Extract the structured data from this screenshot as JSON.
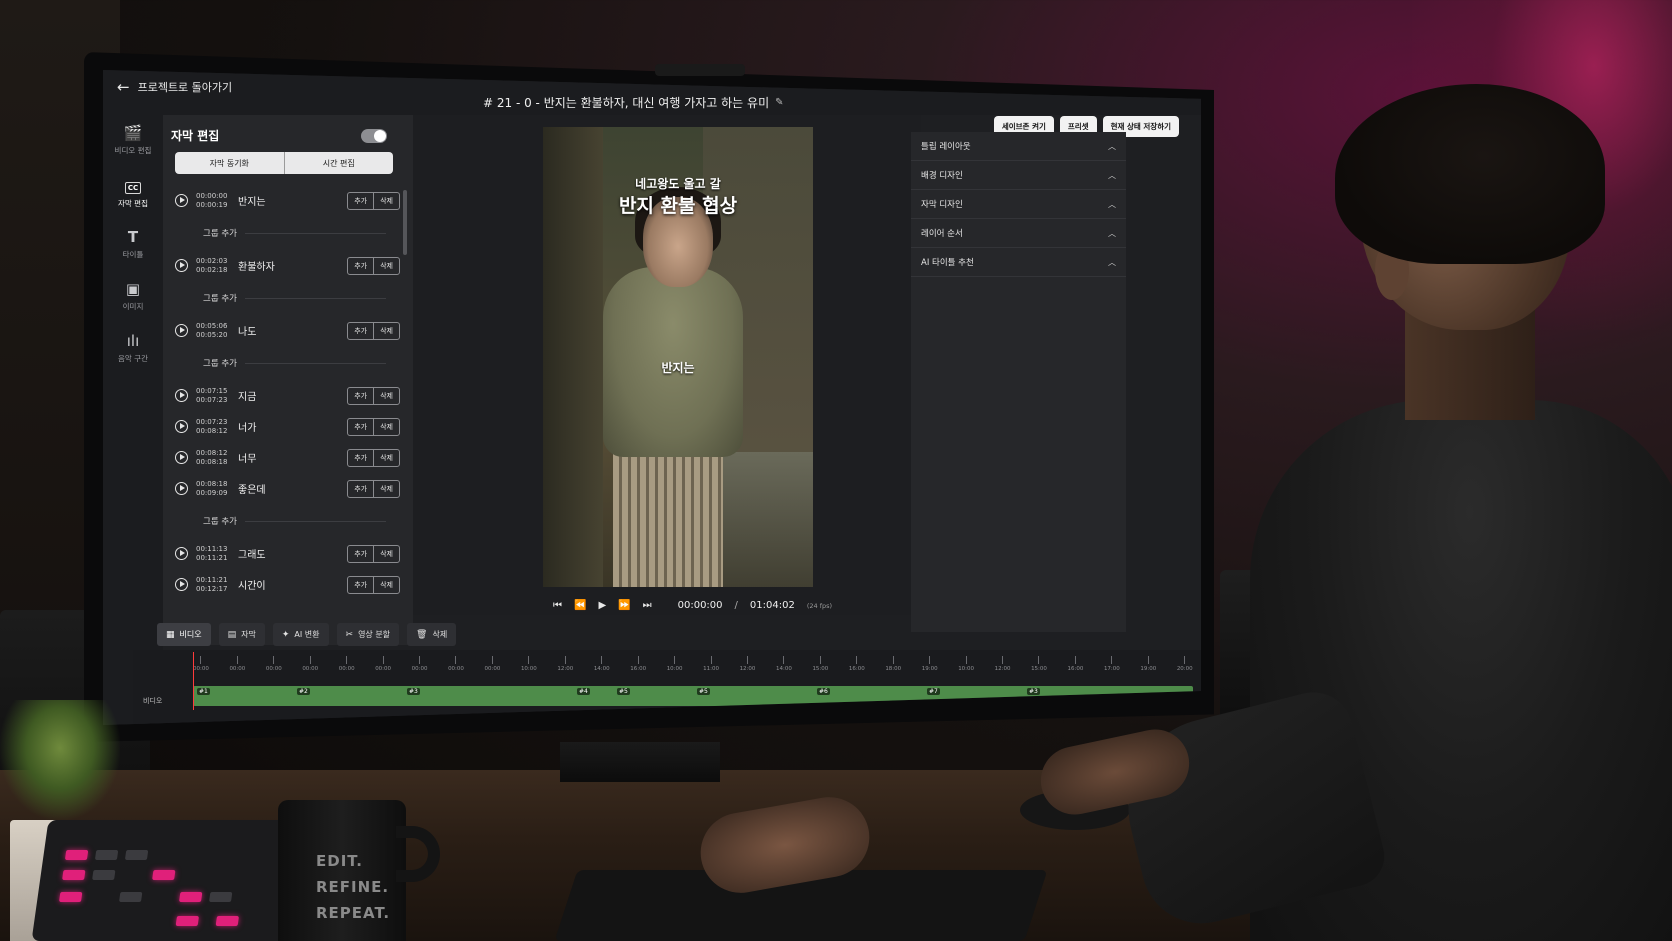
{
  "header": {
    "back_label": "프로젝트로 돌아가기",
    "project_title": "# 21 - 0 - 반지는 환불하자, 대신 여행 가자고 하는 유미",
    "actions": [
      "세이브존 켜기",
      "프리셋",
      "현재 상태 저장하기"
    ]
  },
  "rail": {
    "items": [
      {
        "label": "비디오 편집",
        "icon": "film-icon"
      },
      {
        "label": "자막 편집",
        "icon": "cc-icon"
      },
      {
        "label": "타이틀",
        "icon": "text-icon"
      },
      {
        "label": "이미지",
        "icon": "image-icon"
      },
      {
        "label": "음악 구간",
        "icon": "audio-wave-icon"
      }
    ]
  },
  "subtitle_panel": {
    "title": "자막 편집",
    "toggle_on": true,
    "tabs": [
      "자막 동기화",
      "시간 편집"
    ],
    "add_label": "추가",
    "delete_label": "삭제",
    "group_add_label": "그룹 추가",
    "groups": [
      {
        "rows": [
          {
            "start": "00:00:00",
            "end": "00:00:19",
            "text": "반지는"
          }
        ]
      },
      {
        "rows": [
          {
            "start": "00:02:03",
            "end": "00:02:18",
            "text": "환불하자"
          }
        ]
      },
      {
        "rows": [
          {
            "start": "00:05:06",
            "end": "00:05:20",
            "text": "나도"
          }
        ]
      },
      {
        "rows": [
          {
            "start": "00:07:15",
            "end": "00:07:23",
            "text": "지금"
          },
          {
            "start": "00:07:23",
            "end": "00:08:12",
            "text": "너가"
          },
          {
            "start": "00:08:12",
            "end": "00:08:18",
            "text": "너무"
          },
          {
            "start": "00:08:18",
            "end": "00:09:09",
            "text": "좋은데"
          }
        ]
      },
      {
        "rows": [
          {
            "start": "00:11:13",
            "end": "00:11:21",
            "text": "그래도"
          },
          {
            "start": "00:11:21",
            "end": "00:12:17",
            "text": "시간이"
          }
        ]
      }
    ]
  },
  "preview": {
    "caption_small": "네고왕도 울고 갈",
    "caption_big": "반지 환불 협상",
    "caption_mid": "반지는",
    "current_time": "00:00:00",
    "separator": "/",
    "total_time": "01:04:02",
    "fps": "(24 fps)"
  },
  "right_panel": {
    "sections": [
      "틀립 레이아웃",
      "배경 디자인",
      "자막 디자인",
      "레이어 순서",
      "AI 타이틀 추천"
    ]
  },
  "bottom_toolbar": {
    "buttons": [
      {
        "label": "비디오",
        "icon": "film-icon"
      },
      {
        "label": "자막",
        "icon": "cc-icon"
      },
      {
        "label": "AI 변환",
        "icon": "sparkle-icon"
      },
      {
        "label": "영상 분할",
        "icon": "scissors-icon"
      },
      {
        "label": "삭제",
        "icon": "trash-icon"
      }
    ]
  },
  "timeline": {
    "track_label": "비디오",
    "ticks": [
      "00:00",
      "00:00",
      "00:00",
      "00:00",
      "00:00",
      "00:00",
      "00:00",
      "00:00",
      "00:00",
      "10:00",
      "12:00",
      "14:00",
      "16:00",
      "10:00",
      "11:00",
      "12:00",
      "14:00",
      "15:00",
      "16:00",
      "18:00",
      "19:00",
      "10:00",
      "12:00",
      "15:00",
      "16:00",
      "17:00",
      "19:00",
      "20:00"
    ],
    "clips": [
      "#1",
      "#2",
      "#3",
      "#4",
      "#5",
      "#5",
      "#6",
      "#7",
      "#3"
    ]
  },
  "scene": {
    "mug_lines": [
      "EDIT.",
      "REFINE.",
      "REPEAT."
    ]
  },
  "colors": {
    "accent_pink": "#e0207a",
    "track_green": "#4e8c4a",
    "playhead_red": "#ff3b3b"
  }
}
